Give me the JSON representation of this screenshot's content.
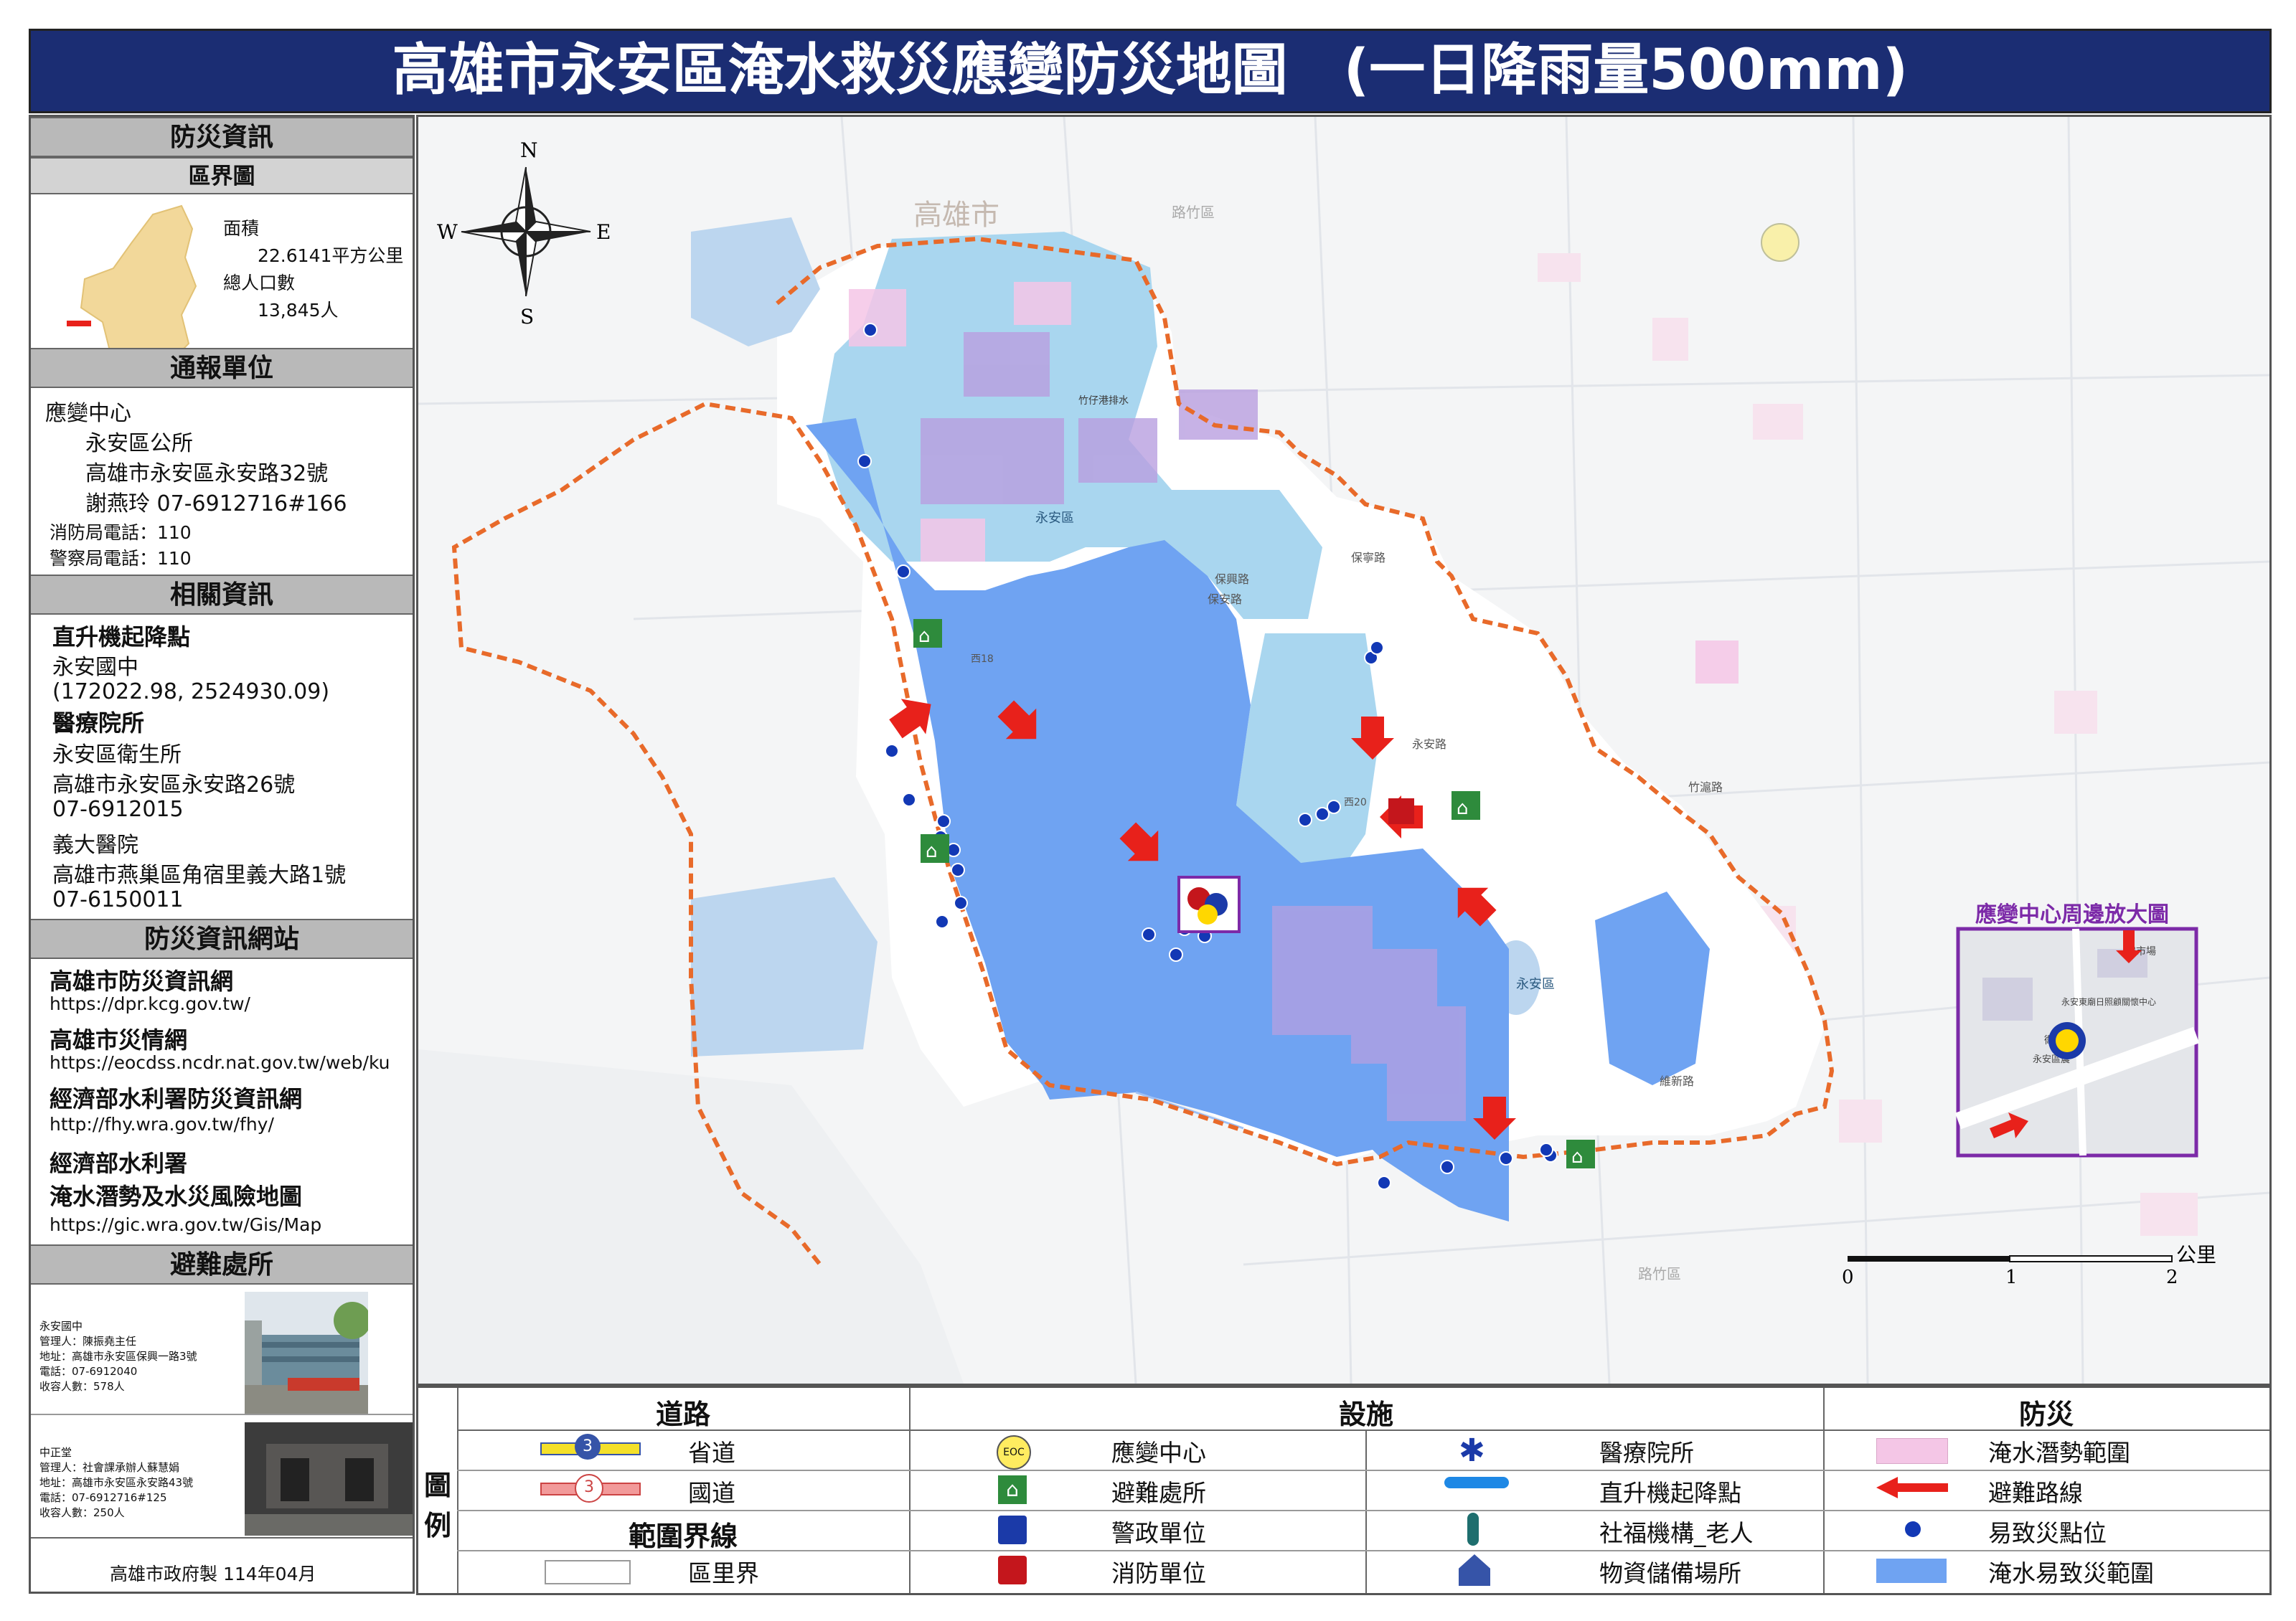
{
  "title": "高雄市永安區淹水救災應變防災地圖　(一日降雨量500mm)",
  "panel": {
    "section_info": "防災資訊",
    "district_map": {
      "header": "區界圖",
      "area_label": "面積",
      "area_value": "22.6141平方公里",
      "population_label": "總人口數",
      "population_value": "13,845人"
    },
    "report": {
      "header": "通報單位",
      "center_label": "應變中心",
      "office": "永安區公所",
      "address": "高雄市永安區永安路32號",
      "contact": "謝燕玲  07-6912716#166",
      "fire_phone": "消防局電話：110",
      "police_phone": "警察局電話：110"
    },
    "related": {
      "header": "相關資訊",
      "heli_label": "直升機起降點",
      "heli_name": "永安國中",
      "heli_coords": "(172022.98, 2524930.09)",
      "medical_label": "醫療院所",
      "med1_name": "永安區衛生所",
      "med1_address": "高雄市永安區永安路26號",
      "med1_phone": "07-6912015",
      "med2_name": "義大醫院",
      "med2_address": "高雄市燕巢區角宿里義大路1號",
      "med2_phone": "07-6150011"
    },
    "websites": {
      "header": "防災資訊網站",
      "items": [
        {
          "name": "高雄市防災資訊網",
          "url": "https://dpr.kcg.gov.tw/"
        },
        {
          "name": "高雄市災情網",
          "url": "https://eocdss.ncdr.nat.gov.tw/web/ku"
        },
        {
          "name": "經濟部水利署防災資訊網",
          "url": "http://fhy.wra.gov.tw/fhy/"
        },
        {
          "name": "經濟部水利署\n淹水潛勢及水災風險地圖",
          "url": "https://gic.wra.gov.tw/Gis/Map"
        }
      ]
    },
    "shelters": {
      "header": "避難處所",
      "items": [
        {
          "text": "永安國中\n管理人：陳振堯主任\n地址：高雄市永安區保興一路3號\n電話：07-6912040\n收容人數：578人"
        },
        {
          "text": "中正堂\n管理人：社會課承辦人蘇慧娟\n地址：高雄市永安區永安路43號\n電話：07-6912716#125\n收容人數：250人"
        }
      ]
    },
    "footer": "高雄市政府製  114年04月"
  },
  "map": {
    "compass": {
      "n": "N",
      "s": "S",
      "e": "E",
      "w": "W"
    },
    "labels": {
      "city": "高雄市",
      "district_top": "永安區",
      "district_bottom": "永安區",
      "road_lu_zhu": "路竹區",
      "road_a": "竹仔港排水",
      "road_b": "保寧路",
      "road_c": "保興路",
      "road_d": "保安路",
      "road_e": "西18",
      "road_f": "西20",
      "road_g": "永安路",
      "road_h": "維新路",
      "road_i": "竹滬路",
      "road_j": "路竹區"
    },
    "inset": {
      "title": "應變中心周邊放大圖",
      "l1": "安市場",
      "l2": "永安東廟日照顧關懷中心",
      "l3": "永安區農",
      "l4": "衛"
    },
    "scale": {
      "unit": "公里",
      "ticks": [
        "0",
        "1",
        "2"
      ]
    }
  },
  "legend": {
    "side_label": "圖\n例",
    "road_header": "道路",
    "facility_header": "設施",
    "disaster_header": "防災",
    "boundary_header": "範圍界線",
    "road_items": [
      "省道",
      "國道"
    ],
    "road_badges": [
      "3",
      "3"
    ],
    "boundary_item": "區里界",
    "facility_col1": [
      "應變中心",
      "避難處所",
      "警政單位",
      "消防單位"
    ],
    "facility_col2": [
      "醫療院所",
      "直升機起降點",
      "社福機構_老人",
      "物資儲備場所"
    ],
    "eoc_badge": "EOC",
    "disaster_items": [
      "淹水潛勢範圍",
      "避難路線",
      "易致災點位",
      "淹水易致災範圍"
    ]
  },
  "colors": {
    "title_bg": "#1b2d73",
    "flood_prone": "#6fa3f2",
    "flood_potential": "#f4c6e6",
    "evac_route": "#e8211b",
    "disaster_point": "#1238b5",
    "boundary": "#e86a2a",
    "water": "#bcd6ef",
    "urban_light": "#a9d6ef",
    "purple_area": "#b99fe0",
    "inset_border": "#7c2aa8"
  }
}
